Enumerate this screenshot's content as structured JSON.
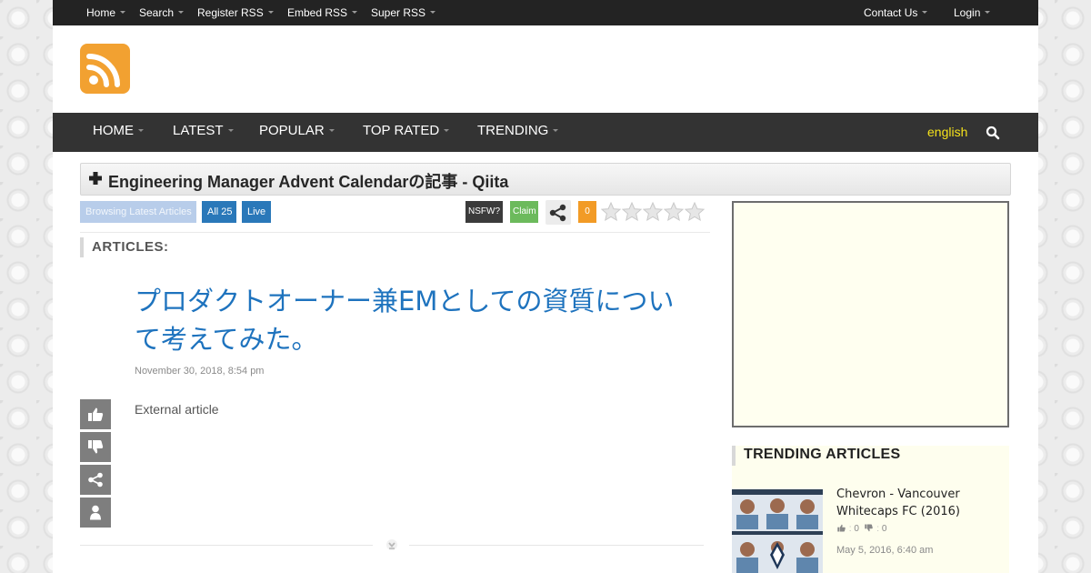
{
  "topbar": {
    "left": [
      "Home",
      "Search",
      "Register RSS",
      "Embed RSS",
      "Super RSS"
    ],
    "right": [
      "Contact Us",
      "Login"
    ]
  },
  "logo_icon": "rss-icon",
  "mainnav": {
    "items": [
      "HOME",
      "LATEST",
      "POPULAR",
      "TOP RATED",
      "TRENDING"
    ],
    "language": "english",
    "search_icon": "search-icon"
  },
  "feed": {
    "title": "Engineering Manager Advent Calendarの記事 - Qiita"
  },
  "toolbar": {
    "browse": "Browsing Latest Articles",
    "all": "All 25",
    "live": "Live",
    "nsfw": "NSFW?",
    "claim": "Claim",
    "count": "0",
    "rating_stars": 5,
    "rating_value": 0
  },
  "articles_label": "ARTICLES:",
  "article": {
    "title": "プロダクトオーナー兼EMとしての資質について考えてみた。",
    "date": "November 30, 2018, 8:54 pm",
    "body": "External article"
  },
  "side_actions": [
    "thumbs-up-icon",
    "thumbs-down-icon",
    "share-icon",
    "user-icon"
  ],
  "trending": {
    "heading": "TRENDING ARTICLES",
    "items": [
      {
        "title": "Chevron - Vancouver Whitecaps FC (2016)",
        "up": "0",
        "down": "0",
        "date": "May 5, 2016, 6:40 am"
      }
    ]
  },
  "colors": {
    "topbar": "#232323",
    "mainnav": "#333333",
    "accent_blue": "#2a78b9",
    "title_blue": "#1e73be",
    "rss_orange": "#f2a131",
    "language_yellow": "#f5e21b"
  }
}
